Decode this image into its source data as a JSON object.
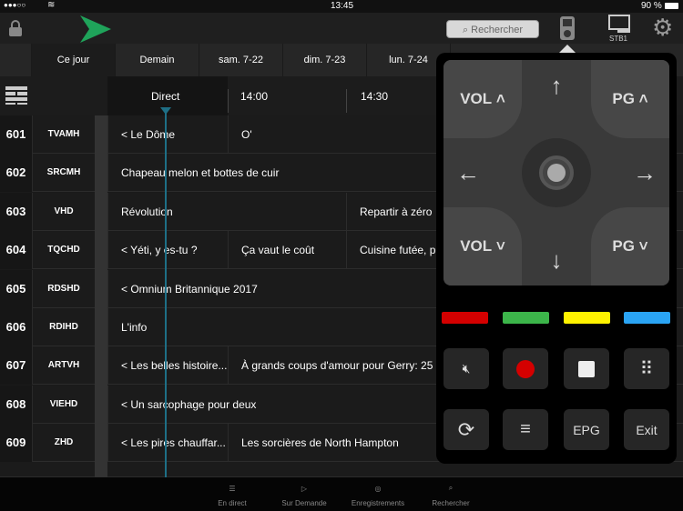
{
  "status": {
    "carrier": "●●●○○",
    "time": "13:45",
    "battery": "90 %"
  },
  "header": {
    "search_placeholder": "Rechercher",
    "stb_label": "STB1"
  },
  "dates": [
    "Ce jour",
    "Demain",
    "sam. 7-22",
    "dim. 7-23",
    "lun. 7-24"
  ],
  "timeline": {
    "now": "Direct",
    "t1": "14:00",
    "t2": "14:30"
  },
  "rows": [
    {
      "num": "601",
      "chan": "TVAMH",
      "progs": [
        {
          "slot": 0,
          "title": "< Le Dôme"
        },
        {
          "slot": 1,
          "title": "O'"
        }
      ]
    },
    {
      "num": "602",
      "chan": "SRCMH",
      "progs": [
        {
          "slot": 0,
          "title": "Chapeau melon et bottes de cuir"
        }
      ]
    },
    {
      "num": "603",
      "chan": "VHD",
      "progs": [
        {
          "slot": 0,
          "title": "Révolution"
        },
        {
          "slot": 2,
          "title": "Repartir à zéro"
        }
      ]
    },
    {
      "num": "604",
      "chan": "TQCHD",
      "progs": [
        {
          "slot": 0,
          "title": "< Yéti, y es-tu ?"
        },
        {
          "slot": 1,
          "title": "Ça vaut le coût"
        },
        {
          "slot": 2,
          "title": "Cuisine futée, p"
        }
      ]
    },
    {
      "num": "605",
      "chan": "RDSHD",
      "progs": [
        {
          "slot": 0,
          "title": "< Omnium Britannique 2017"
        }
      ]
    },
    {
      "num": "606",
      "chan": "RDIHD",
      "progs": [
        {
          "slot": 0,
          "title": "L'info"
        }
      ]
    },
    {
      "num": "607",
      "chan": "ARTVH",
      "progs": [
        {
          "slot": 0,
          "title": "< Les belles histoire..."
        },
        {
          "slot": 1,
          "title": "À grands coups d'amour pour Gerry: 25 a"
        }
      ]
    },
    {
      "num": "608",
      "chan": "VIEHD",
      "progs": [
        {
          "slot": 0,
          "title": "< Un sarcophage pour deux"
        }
      ]
    },
    {
      "num": "609",
      "chan": "ZHD",
      "progs": [
        {
          "slot": 0,
          "title": "< Les pires chauffar..."
        },
        {
          "slot": 1,
          "title": "Les sorcières de North Hampton"
        }
      ]
    }
  ],
  "remote": {
    "vol_up": "VOL",
    "vol_down": "VOL",
    "pg_up": "PG",
    "pg_down": "PG",
    "epg": "EPG",
    "exit": "Exit",
    "colors": [
      "#d40000",
      "#3cb54a",
      "#fff200",
      "#2aa4f4"
    ]
  },
  "tabs": [
    "En direct",
    "Sur Demande",
    "Enregistrements",
    "Rechercher"
  ]
}
